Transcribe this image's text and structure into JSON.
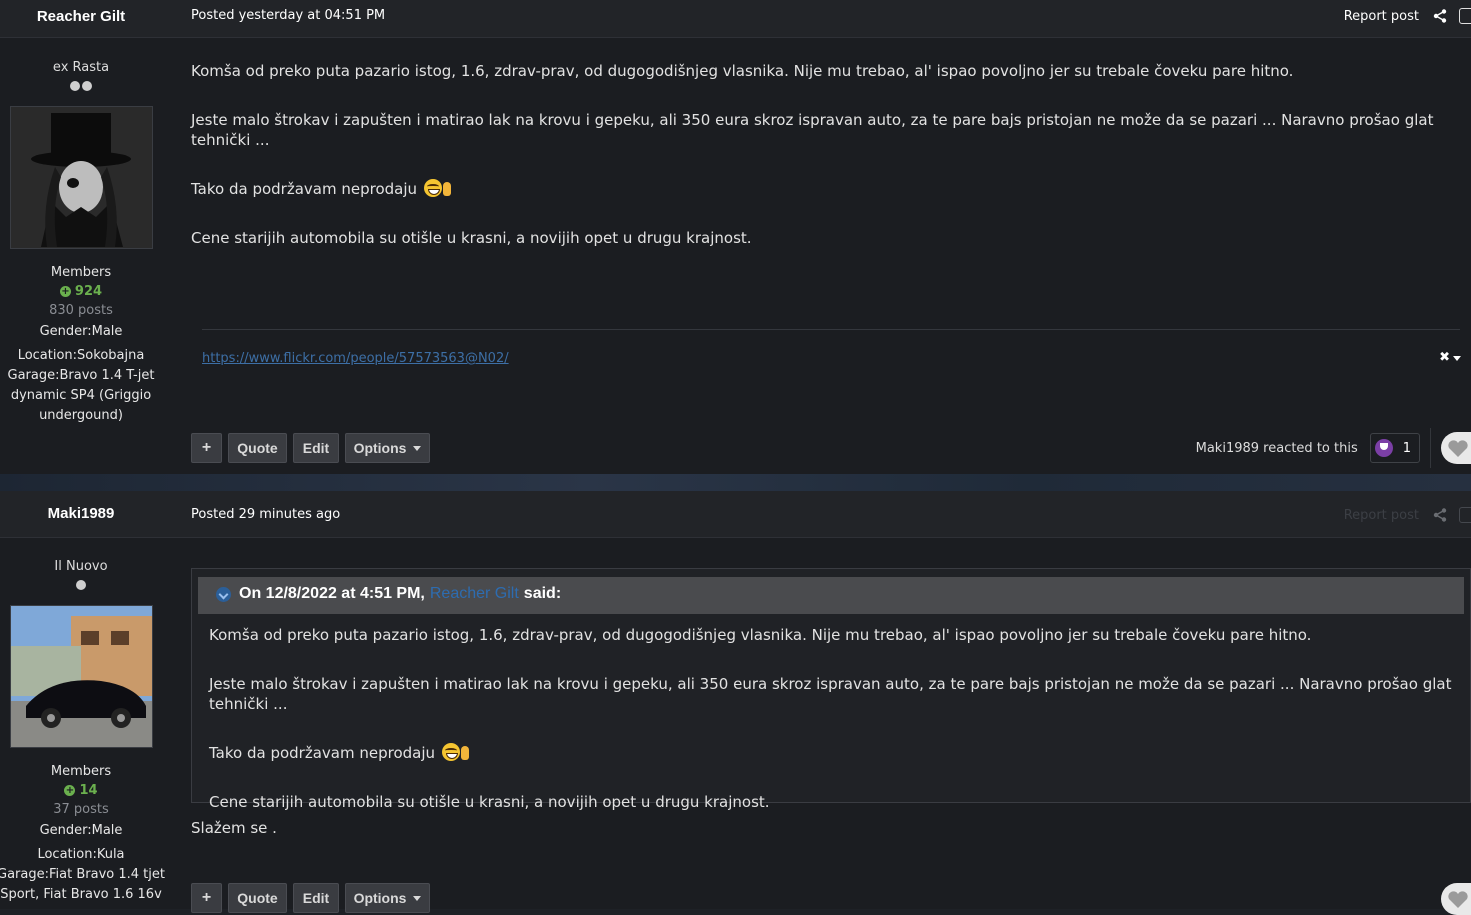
{
  "posts": [
    {
      "author": "Reacher Gilt",
      "posted": "Posted yesterday at 04:51 PM",
      "report_label": "Report post",
      "member_title": "ex Rasta",
      "pips": 2,
      "group": "Members",
      "reputation": "924",
      "post_count": "830 posts",
      "gender": "Gender:Male",
      "location": "Location:Sokobajna",
      "garage": "Garage:Bravo 1.4 T-jet dynamic SP4 (Griggio undergound)",
      "body": [
        "Komša od preko puta pazario istog, 1.6, zdrav-prav, od dugogodišnjeg vlasnika. Nije mu trebao, al' ispao povoljno jer su trebale čoveku pare hitno.",
        "Jeste malo štrokav i zapušten i matirao lak na krovu i gepeku, ali 350 eura skroz ispravan auto, za te pare bajs pristojan ne može da se pazari ... Naravno prošao glat tehnički ...",
        "Tako da podržavam neprodaju ",
        "Cene starijih automobila su otišle u krasni, a novijih opet u drugu krajnost."
      ],
      "signature_link": "https://www.flickr.com/people/57573563@N02/",
      "buttons": {
        "plus": "+",
        "quote": "Quote",
        "edit": "Edit",
        "options": "Options"
      },
      "reacted_text": "Maki1989 reacted to this",
      "reaction_count": "1"
    },
    {
      "author": "Maki1989",
      "posted": "Posted 29 minutes ago",
      "report_label": "Report post",
      "member_title": "Il Nuovo",
      "pips": 1,
      "group": "Members",
      "reputation": "14",
      "post_count": "37 posts",
      "gender": "Gender:Male",
      "location": "Location:Kula",
      "garage": "Garage:Fiat Bravo 1.4 tjet Sport, Fiat Bravo 1.6 16v",
      "quote": {
        "prefix": "On 12/8/2022 at 4:51 PM,",
        "user": "Reacher Gilt",
        "suffix": "said:",
        "body": [
          "Komša od preko puta pazario istog, 1.6, zdrav-prav, od dugogodišnjeg vlasnika. Nije mu trebao, al' ispao povoljno jer su trebale čoveku pare hitno.",
          "Jeste malo štrokav i zapušten i matirao lak na krovu i gepeku, ali 350 eura skroz ispravan auto, za te pare bajs pristojan ne može da se pazari ... Naravno prošao glat tehnički ...",
          "Tako da podržavam neprodaju ",
          "Cene starijih automobila su otišle u krasni, a novijih opet u drugu krajnost."
        ]
      },
      "reply": "Slažem se .",
      "buttons": {
        "plus": "+",
        "quote": "Quote",
        "edit": "Edit",
        "options": "Options"
      }
    }
  ],
  "icons": {
    "share": "share-icon",
    "emoji": "grinning-emoji",
    "hand": "ok-hand-emoji",
    "trophy": "trophy-icon",
    "heart": "heart-icon",
    "quote": "quote-arrow-icon"
  },
  "colors": {
    "background": "#1b1d21",
    "reputation": "#6bb04e",
    "link": "#3d6fa6",
    "quote_user": "#2d6cb0"
  }
}
